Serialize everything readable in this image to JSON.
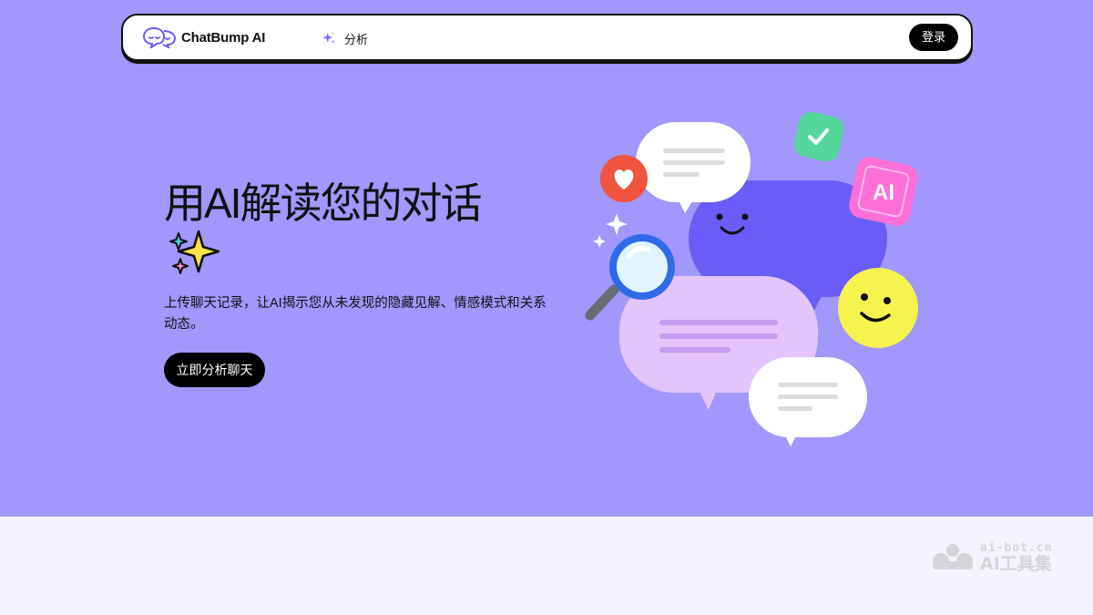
{
  "navbar": {
    "brand_name": "ChatBump AI",
    "brand_icon": "chat-faces-logo-icon",
    "nav_link_label": "分析",
    "nav_link_icon": "sparkle-icon",
    "login_label": "登录"
  },
  "hero": {
    "title": "用AI解读您的对话",
    "title_emoji": "sparkles-icon",
    "description": "上传聊天记录，让AI揭示您从未发现的隐藏见解、情感模式和关系动态。",
    "cta_label": "立即分析聊天"
  },
  "illustration": {
    "badge_text": "AI",
    "icons": [
      "heart-icon",
      "check-icon",
      "magnifier-icon",
      "smiley-icon",
      "speech-bubble-icon"
    ]
  },
  "watermark": {
    "domain": "ai-bot.cn",
    "name": "AI工具集"
  },
  "colors": {
    "hero_background": "#a197fd",
    "page_background": "#f5f3fe",
    "accent_purple": "#6a5cf6",
    "button_black": "#000000"
  }
}
